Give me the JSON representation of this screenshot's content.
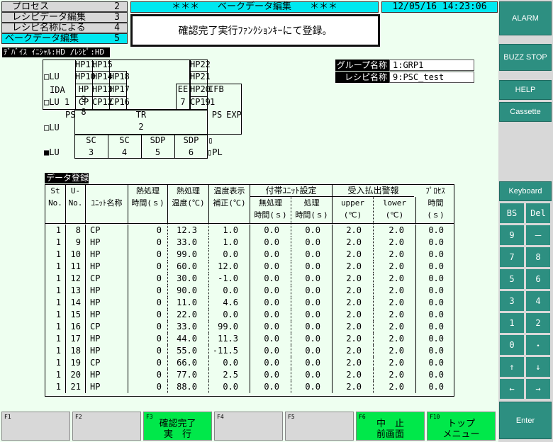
{
  "menu": [
    {
      "label": "プロセス",
      "num": "2"
    },
    {
      "label": "レシピデータ編集",
      "num": "3"
    },
    {
      "label": "レシピ名称による",
      "num": "4"
    },
    {
      "label": "ベークデータ編集",
      "num": "5"
    }
  ],
  "title": "＊＊＊　　ベークデータ編集　　＊＊＊",
  "datetime": "12/05/16 14:23:06",
  "message": "確認完了実行ﾌｧﾝｸｼｮﾝｷｰにて登録。",
  "device_label": "ﾃﾞﾊﾞｲｽ ｲﾆｼｬﾙ:HD /ﾚｼﾋﾟ:HD",
  "group": {
    "label": "グループ名称",
    "value": "1:GRP1"
  },
  "recipe": {
    "label": "レシピ名称",
    "value": "9:PSC_test"
  },
  "side_buttons": [
    "ALARM",
    "BUZZ STOP",
    "HELP",
    "Cassette"
  ],
  "keyboard": {
    "title": "Keyboard",
    "keys": [
      "BS",
      "Del",
      "9",
      "－",
      "7",
      "8",
      "5",
      "6",
      "3",
      "4",
      "1",
      "2",
      "0",
      "・",
      "↑",
      "↓",
      "←",
      "→"
    ],
    "enter": "Enter"
  },
  "diagram": {
    "hp_labels": [
      "HP11",
      "HP15",
      "HP22",
      "HP10",
      "HP14",
      "HP18",
      "HP21",
      "HP 9",
      "HP13",
      "HP17",
      "EE",
      "HP20",
      "IFB",
      "CP 8",
      "CP12",
      "CP16",
      "7",
      "CP19",
      "1"
    ],
    "left_labels": [
      "LU",
      "IDA",
      "LU 1",
      "PS",
      "LU",
      "LU"
    ],
    "tr": "TR",
    "tr_num": "2",
    "ps_right": "PS",
    "exp": "EXP",
    "sc": [
      {
        "label": "SC",
        "num": "3"
      },
      {
        "label": "SC",
        "num": "4"
      },
      {
        "label": "SDP",
        "num": "5"
      },
      {
        "label": "SDP",
        "num": "6"
      }
    ],
    "pl": "PL"
  },
  "table": {
    "title": "データ登録",
    "group_headers": [
      "付帯ﾕﾆｯﾄ設定",
      "受入払出警報",
      "ﾌﾟﾛｾｽ"
    ],
    "headers": [
      [
        "St",
        "No."
      ],
      [
        "U-",
        "No."
      ],
      [
        "",
        "ﾕﾆｯﾄ名称"
      ],
      [
        "熱処理",
        "時間(ｓ)"
      ],
      [
        "熱処理",
        "温度(℃)"
      ],
      [
        "温度表示",
        "補正(℃)"
      ],
      [
        "",
        "無処理",
        "時間(ｓ)"
      ],
      [
        "",
        "処理",
        "時間(ｓ)"
      ],
      [
        "upper",
        "(℃)"
      ],
      [
        "lower",
        "(℃)"
      ],
      [
        "時間",
        "(ｓ)"
      ]
    ],
    "rows": [
      [
        "1",
        "8",
        "CP",
        "0",
        "12.3",
        "1.0",
        "0.0",
        "0.0",
        "2.0",
        "2.0",
        "0.0"
      ],
      [
        "1",
        "9",
        "HP",
        "0",
        "33.0",
        "1.0",
        "0.0",
        "0.0",
        "2.0",
        "2.0",
        "0.0"
      ],
      [
        "1",
        "10",
        "HP",
        "0",
        "99.0",
        "0.0",
        "0.0",
        "0.0",
        "2.0",
        "2.0",
        "0.0"
      ],
      [
        "1",
        "11",
        "HP",
        "0",
        "60.0",
        "12.0",
        "0.0",
        "0.0",
        "2.0",
        "2.0",
        "0.0"
      ],
      [
        "1",
        "12",
        "CP",
        "0",
        "30.0",
        "-1.0",
        "0.0",
        "0.0",
        "2.0",
        "2.0",
        "0.0"
      ],
      [
        "1",
        "13",
        "HP",
        "0",
        "90.0",
        "0.0",
        "0.0",
        "0.0",
        "2.0",
        "2.0",
        "0.0"
      ],
      [
        "1",
        "14",
        "HP",
        "0",
        "11.0",
        "4.6",
        "0.0",
        "0.0",
        "2.0",
        "2.0",
        "0.0"
      ],
      [
        "1",
        "15",
        "HP",
        "0",
        "22.0",
        "0.0",
        "0.0",
        "0.0",
        "2.0",
        "2.0",
        "0.0"
      ],
      [
        "1",
        "16",
        "CP",
        "0",
        "33.0",
        "99.0",
        "0.0",
        "0.0",
        "2.0",
        "2.0",
        "0.0"
      ],
      [
        "1",
        "17",
        "HP",
        "0",
        "44.0",
        "11.3",
        "0.0",
        "0.0",
        "2.0",
        "2.0",
        "0.0"
      ],
      [
        "1",
        "18",
        "HP",
        "0",
        "55.0",
        "-11.5",
        "0.0",
        "0.0",
        "2.0",
        "2.0",
        "0.0"
      ],
      [
        "1",
        "19",
        "CP",
        "0",
        "66.0",
        "0.0",
        "0.0",
        "0.0",
        "2.0",
        "2.0",
        "0.0"
      ],
      [
        "1",
        "20",
        "HP",
        "0",
        "77.0",
        "2.5",
        "0.0",
        "0.0",
        "2.0",
        "2.0",
        "0.0"
      ],
      [
        "1",
        "21",
        "HP",
        "0",
        "88.0",
        "0.0",
        "0.0",
        "0.0",
        "2.0",
        "2.0",
        "0.0"
      ]
    ]
  },
  "fkeys": [
    {
      "id": "F1",
      "text": ""
    },
    {
      "id": "F2",
      "text": ""
    },
    {
      "id": "F3",
      "text": "確認完了\n実　行"
    },
    {
      "id": "F4",
      "text": ""
    },
    {
      "id": "F5",
      "text": ""
    },
    {
      "id": "F6",
      "text": "中　止\n前画面"
    },
    {
      "id": "F10",
      "text": "トップ\nメニュー"
    }
  ]
}
